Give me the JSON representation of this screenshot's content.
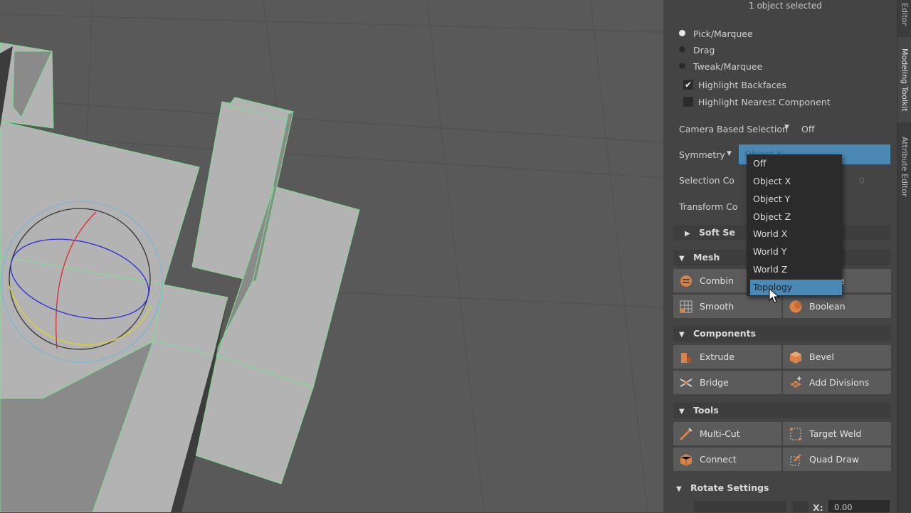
{
  "panel": {
    "selection_count": "1 object selected",
    "selection_modes": [
      {
        "label": "Pick/Marquee",
        "selected": true
      },
      {
        "label": "Drag",
        "selected": false
      },
      {
        "label": "Tweak/Marquee",
        "selected": false
      }
    ],
    "highlight_backfaces": {
      "label": "Highlight Backfaces",
      "checked": true
    },
    "highlight_nearest": {
      "label": "Highlight Nearest Component",
      "checked": false
    },
    "camera_based_selection": {
      "label": "Camera Based Selection",
      "value": "Off"
    },
    "symmetry": {
      "label": "Symmetry",
      "value": "Object X"
    },
    "selection_constraint": {
      "label": "Selection Co",
      "value": "0"
    },
    "transform_constraint": {
      "label": "Transform Co"
    },
    "soft_selection": {
      "label": "Soft Se"
    },
    "sections": {
      "mesh": "Mesh",
      "components": "Components",
      "tools": "Tools",
      "rotate_settings": "Rotate Settings"
    },
    "mesh_buttons": {
      "combine": "Combin",
      "separate": "e",
      "smooth": "Smooth",
      "boolean": "Boolean"
    },
    "component_buttons": {
      "extrude": "Extrude",
      "bevel": "Bevel",
      "bridge": "Bridge",
      "add_divisions": "Add Divisions"
    },
    "tool_buttons": {
      "multi_cut": "Multi-Cut",
      "target_weld": "Target Weld",
      "connect": "Connect",
      "quad_draw": "Quad Draw"
    },
    "rotate": {
      "axis_label": "X:",
      "value": "0.00"
    }
  },
  "side_tabs": {
    "top": "Editor",
    "middle": "Modeling Toolkit",
    "bottom": "Attribute Editor"
  },
  "symmetry_dropdown": {
    "options": [
      "Off",
      "Object X",
      "Object Y",
      "Object Z",
      "World X",
      "World Y",
      "World Z",
      "Topology"
    ],
    "highlighted": "Topology"
  },
  "colors": {
    "accent": "#4b88b5",
    "viewport_bg": "#595959",
    "mesh_face": "#b3b3b3",
    "wireframe": "#7ce08e",
    "panel_bg": "#444444",
    "button_bg": "#5b5b5b",
    "icon_orange": "#d9824a"
  }
}
